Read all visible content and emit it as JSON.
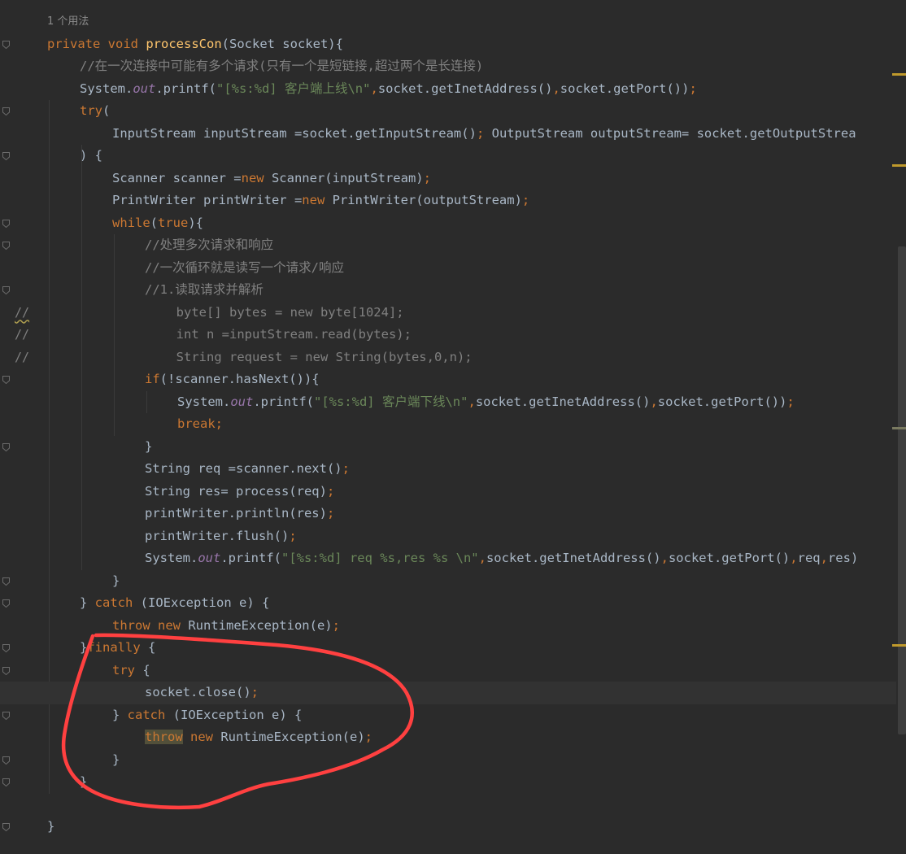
{
  "editor": {
    "usage_hint": "1 个用法",
    "lines": [
      {
        "segments": [
          [
            "kw",
            "private "
          ],
          [
            "kw",
            "void "
          ],
          [
            "fn",
            "processCon"
          ],
          [
            "",
            "(Socket socket){"
          ]
        ]
      },
      {
        "segments": [
          [
            "cm",
            "//在一次连接中可能有多个请求(只有一个是短链接,超过两个是长连接)"
          ]
        ]
      },
      {
        "segments": [
          [
            "",
            "System."
          ],
          [
            "field",
            "out"
          ],
          [
            "",
            ".printf("
          ],
          [
            "str",
            "\"[%s:%d] 客户端上线\\n\""
          ],
          [
            "punc",
            ","
          ],
          [
            "",
            "socket.getInetAddress()"
          ],
          [
            "punc",
            ","
          ],
          [
            "",
            "socket.getPort())"
          ],
          [
            "punc",
            ";"
          ]
        ]
      },
      {
        "segments": [
          [
            "kw",
            "try"
          ],
          [
            "",
            "("
          ]
        ]
      },
      {
        "segments": [
          [
            "",
            "InputStream inputStream =socket.getInputStream()"
          ],
          [
            "punc",
            "; "
          ],
          [
            "",
            "OutputStream outputStream= socket.getOutputStrea"
          ]
        ]
      },
      {
        "segments": [
          [
            "",
            ") {"
          ]
        ]
      },
      {
        "segments": [
          [
            "",
            "Scanner scanner ="
          ],
          [
            "kw",
            "new "
          ],
          [
            "",
            "Scanner(inputStream)"
          ],
          [
            "punc",
            ";"
          ]
        ]
      },
      {
        "segments": [
          [
            "",
            "PrintWriter printWriter ="
          ],
          [
            "kw",
            "new "
          ],
          [
            "",
            "PrintWriter(outputStream)"
          ],
          [
            "punc",
            ";"
          ]
        ]
      },
      {
        "segments": [
          [
            "kw",
            "while"
          ],
          [
            "",
            "("
          ],
          [
            "kw",
            "true"
          ],
          [
            "",
            "){"
          ]
        ]
      },
      {
        "segments": [
          [
            "cm",
            "//处理多次请求和响应"
          ]
        ]
      },
      {
        "segments": [
          [
            "cm",
            "//一次循环就是读写一个请求/响应"
          ]
        ]
      },
      {
        "segments": [
          [
            "cm",
            "//1.读取请求并解析"
          ]
        ]
      },
      {
        "segments": [
          [
            "cm",
            "  byte[] bytes = new byte[1024];"
          ]
        ]
      },
      {
        "segments": [
          [
            "cm",
            "  int n =inputStream.read(bytes);"
          ]
        ]
      },
      {
        "segments": [
          [
            "cm",
            "  String request = new String(bytes,0,n);"
          ]
        ]
      },
      {
        "segments": [
          [
            "kw",
            "if"
          ],
          [
            "",
            "(!scanner.hasNext()){"
          ]
        ]
      },
      {
        "segments": [
          [
            "",
            "System."
          ],
          [
            "field",
            "out"
          ],
          [
            "",
            ".printf("
          ],
          [
            "str",
            "\"[%s:%d] 客户端下线\\n\""
          ],
          [
            "punc",
            ","
          ],
          [
            "",
            "socket.getInetAddress()"
          ],
          [
            "punc",
            ","
          ],
          [
            "",
            "socket.getPort())"
          ],
          [
            "punc",
            ";"
          ]
        ]
      },
      {
        "segments": [
          [
            "kw",
            "break"
          ],
          [
            "punc",
            ";"
          ]
        ]
      },
      {
        "segments": [
          [
            "",
            "}"
          ]
        ]
      },
      {
        "segments": [
          [
            "",
            "String req =scanner.next()"
          ],
          [
            "punc",
            ";"
          ]
        ]
      },
      {
        "segments": [
          [
            "",
            "String res= process(req)"
          ],
          [
            "punc",
            ";"
          ]
        ]
      },
      {
        "segments": [
          [
            "",
            "printWriter.println(res)"
          ],
          [
            "punc",
            ";"
          ]
        ]
      },
      {
        "segments": [
          [
            "",
            "printWriter.flush()"
          ],
          [
            "punc",
            ";"
          ]
        ]
      },
      {
        "segments": [
          [
            "",
            "System."
          ],
          [
            "field",
            "out"
          ],
          [
            "",
            ".printf("
          ],
          [
            "str",
            "\"[%s:%d] req %s,res %s \\n\""
          ],
          [
            "punc",
            ","
          ],
          [
            "",
            "socket.getInetAddress()"
          ],
          [
            "punc",
            ","
          ],
          [
            "",
            "socket.getPort()"
          ],
          [
            "punc",
            ","
          ],
          [
            "",
            "req"
          ],
          [
            "punc",
            ","
          ],
          [
            "",
            "res)"
          ]
        ]
      },
      {
        "segments": [
          [
            "",
            "}"
          ]
        ]
      },
      {
        "segments": [
          [
            "",
            "} "
          ],
          [
            "kw",
            "catch "
          ],
          [
            "",
            "(IOException e) {"
          ]
        ]
      },
      {
        "segments": [
          [
            "kw",
            "throw "
          ],
          [
            "kw",
            "new "
          ],
          [
            "",
            "RuntimeException(e)"
          ],
          [
            "punc",
            ";"
          ]
        ]
      },
      {
        "segments": [
          [
            "",
            "}"
          ],
          [
            "kw",
            "finally "
          ],
          [
            "",
            "{"
          ]
        ]
      },
      {
        "segments": [
          [
            "kw",
            "try "
          ],
          [
            "",
            "{"
          ]
        ]
      },
      {
        "segments": [
          [
            "",
            "socket.close()"
          ],
          [
            "punc",
            ";"
          ]
        ]
      },
      {
        "segments": [
          [
            "",
            "} "
          ],
          [
            "kw",
            "catch "
          ],
          [
            "",
            "(IOException e) {"
          ]
        ]
      },
      {
        "segments": [
          [
            "kw hl",
            "throw"
          ],
          [
            "",
            " "
          ],
          [
            "kw",
            "new "
          ],
          [
            "",
            "RuntimeException(e)"
          ],
          [
            "punc",
            ";"
          ]
        ]
      },
      {
        "segments": [
          [
            "",
            "}"
          ]
        ]
      },
      {
        "segments": [
          [
            "",
            "}"
          ]
        ]
      },
      {
        "segments": [
          [
            "",
            ""
          ]
        ]
      },
      {
        "segments": [
          [
            "",
            "}"
          ]
        ]
      }
    ],
    "gutter_comments": [
      "//",
      "//",
      "//"
    ]
  },
  "annotation": {
    "color": "#ff4040"
  },
  "colors": {
    "background": "#2b2b2b",
    "keyword": "#cc7832",
    "function": "#ffc66d",
    "string": "#6a8759",
    "comment": "#808080",
    "field": "#9876aa",
    "text": "#a9b7c6"
  }
}
